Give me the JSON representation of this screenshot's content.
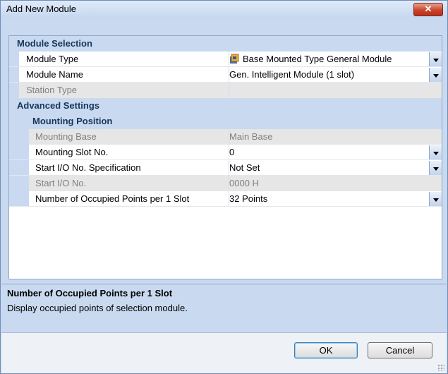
{
  "window": {
    "title": "Add New Module",
    "close_label": "✕"
  },
  "grid": {
    "module_selection": {
      "label": "Module Selection"
    },
    "module_type": {
      "label": "Module Type",
      "value": "Base Mounted Type General Module"
    },
    "module_name": {
      "label": "Module Name",
      "value": "Gen. Intelligent Module (1 slot)"
    },
    "station_type": {
      "label": "Station Type",
      "value": ""
    },
    "advanced_settings": {
      "label": "Advanced Settings"
    },
    "mounting_position": {
      "label": "Mounting Position"
    },
    "mounting_base": {
      "label": "Mounting Base",
      "value": "Main Base"
    },
    "mounting_slot": {
      "label": "Mounting Slot No.",
      "value": "0"
    },
    "start_io_spec": {
      "label": "Start I/O No. Specification",
      "value": "Not Set"
    },
    "start_io_no": {
      "label": "Start I/O No.",
      "value": "0000 H"
    },
    "occupied_points": {
      "label": "Number of Occupied Points per 1 Slot",
      "value": "32 Points"
    }
  },
  "description": {
    "title": "Number of Occupied Points per 1 Slot",
    "body": "Display occupied points of selection module."
  },
  "buttons": {
    "ok": "OK",
    "cancel": "Cancel"
  },
  "icons": {
    "module_type": "module-icon",
    "dropdown": "chevron-down-icon",
    "resize": "resize-grip-icon"
  }
}
